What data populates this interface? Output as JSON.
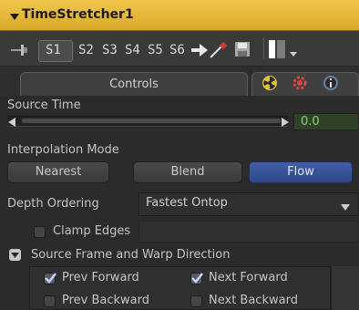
{
  "node": {
    "title": "TimeStretcher1"
  },
  "toolbar": {
    "slots": [
      "S1",
      "S2",
      "S3",
      "S4",
      "S5",
      "S6"
    ],
    "selected_slot": "S1"
  },
  "tabs": {
    "controls_label": "Controls"
  },
  "source_time": {
    "label": "Source Time",
    "value": "0.0"
  },
  "interpolation": {
    "label": "Interpolation Mode",
    "options": [
      "Nearest",
      "Blend",
      "Flow"
    ],
    "selected": "Flow"
  },
  "depth_ordering": {
    "label": "Depth Ordering",
    "value": "Fastest Ontop"
  },
  "clamp_edges": {
    "label": "Clamp Edges",
    "checked": false
  },
  "source_frame_group": {
    "label": "Source Frame and Warp Direction",
    "prev_forward": {
      "label": "Prev Forward",
      "checked": true
    },
    "next_forward": {
      "label": "Next Forward",
      "checked": true
    },
    "prev_backward": {
      "label": "Prev Backward",
      "checked": false
    },
    "next_backward": {
      "label": "Next Backward",
      "checked": false
    }
  },
  "colors": {
    "title_bar": "#e4b83a",
    "selected_button": "#3a57a0",
    "value_text": "#8fd07f"
  }
}
